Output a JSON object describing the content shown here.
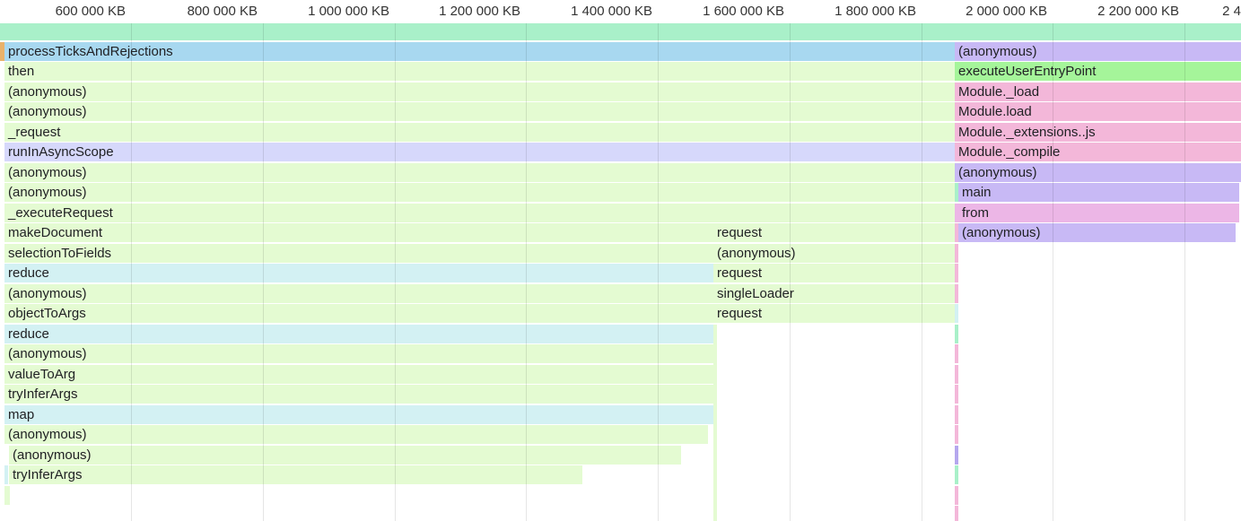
{
  "axis": {
    "ticks": [
      "600 000 KB",
      "800 000 KB",
      "1 000 000 KB",
      "1 200 000 KB",
      "1 400 000 KB",
      "1 600 000 KB",
      "1 800 000 KB",
      "2 000 000 KB",
      "2 200 000 KB",
      "2 4"
    ]
  },
  "colors": {
    "green": "#e4fbd2",
    "blue": "#a8d8f0",
    "purple": "#d6d8fb",
    "cyan": "#d3f1f3",
    "lavender": "#c8b9f5",
    "bright_green": "#a5f59a",
    "pink": "#f3b7d9",
    "overview": "#a9f0c9"
  },
  "frames": {
    "process_ticks": "processTicksAndRejections",
    "then": "then",
    "anonymous": "(anonymous)",
    "request_fn": "_request",
    "run_in_async_scope": "runInAsyncScope",
    "execute_request": "_executeRequest",
    "make_document": "makeDocument",
    "selection_to_fields": "selectionToFields",
    "reduce": "reduce",
    "object_to_args": "objectToArgs",
    "value_to_arg": "valueToArg",
    "try_infer_args": "tryInferArgs",
    "map": "map",
    "request": "request",
    "single_loader": "singleLoader",
    "execute_user_entry_point": "executeUserEntryPoint",
    "module_load_private": "Module._load",
    "module_load": "Module.load",
    "module_extensions_js": "Module._extensions..js",
    "module_compile": "Module._compile",
    "main": "main",
    "from": "from"
  }
}
